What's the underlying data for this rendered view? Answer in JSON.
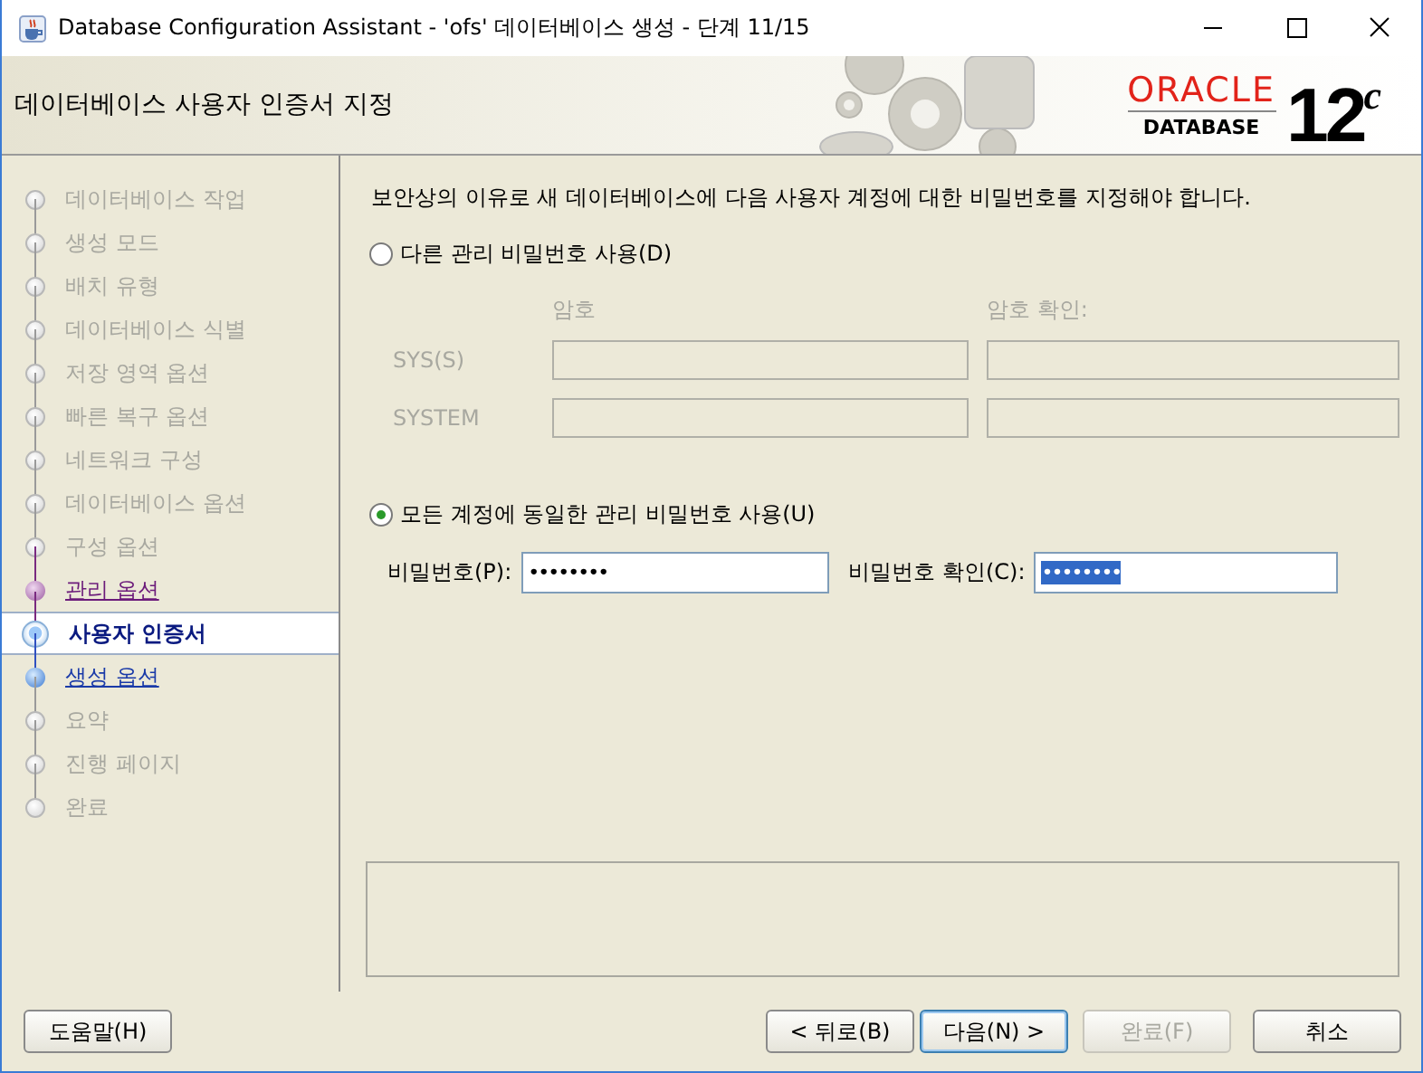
{
  "window": {
    "title": "Database Configuration Assistant - 'ofs' 데이터베이스 생성 - 단계 11/15"
  },
  "header": {
    "title": "데이터베이스 사용자 인증서 지정",
    "logo": {
      "brand": "ORACLE",
      "product": "DATABASE",
      "version": "12",
      "suffix": "c"
    }
  },
  "steps": [
    {
      "label": "데이터베이스 작업",
      "kind": "inactive"
    },
    {
      "label": "생성 모드",
      "kind": "inactive"
    },
    {
      "label": "배치 유형",
      "kind": "inactive"
    },
    {
      "label": "데이터베이스 식별",
      "kind": "inactive"
    },
    {
      "label": "저장 영역 옵션",
      "kind": "inactive"
    },
    {
      "label": "빠른 복구 옵션",
      "kind": "inactive"
    },
    {
      "label": "네트워크 구성",
      "kind": "inactive"
    },
    {
      "label": "데이터베이스 옵션",
      "kind": "inactive"
    },
    {
      "label": "구성 옵션",
      "kind": "inactive"
    },
    {
      "label": "관리 옵션",
      "kind": "visited"
    },
    {
      "label": "사용자 인증서",
      "kind": "current"
    },
    {
      "label": "생성 옵션",
      "kind": "link"
    },
    {
      "label": "요약",
      "kind": "inactive"
    },
    {
      "label": "진행 페이지",
      "kind": "inactive"
    },
    {
      "label": "완료",
      "kind": "inactive"
    }
  ],
  "intro": "보안상의 이유로 새 데이터베이스에 다음 사용자 계정에 대한 비밀번호를 지정해야 합니다.",
  "options": [
    {
      "kind": "separate",
      "label": "다른 관리 비밀번호 사용(D)",
      "selected": false,
      "columns": [
        "암호",
        "암호 확인:"
      ],
      "rows": [
        {
          "label": "SYS(S)"
        },
        {
          "label": "SYSTEM"
        }
      ]
    },
    {
      "kind": "same",
      "label": "모든 계정에 동일한 관리 비밀번호 사용(U)",
      "selected": true,
      "fields": [
        {
          "label": "비밀번호(P):",
          "value": "••••••••",
          "highlighted": false
        },
        {
          "label": "비밀번호 확인(C):",
          "value": "••••••••",
          "highlighted": true
        }
      ]
    }
  ],
  "help_button": {
    "label": "도움말(H)"
  },
  "buttons": [
    {
      "label": "< 뒤로(B)",
      "disabled": false,
      "default": false
    },
    {
      "label": "다음(N) >",
      "disabled": false,
      "default": true
    },
    {
      "label": "완료(F)",
      "disabled": true,
      "default": false
    },
    {
      "label": "취소",
      "disabled": false,
      "default": false
    }
  ]
}
